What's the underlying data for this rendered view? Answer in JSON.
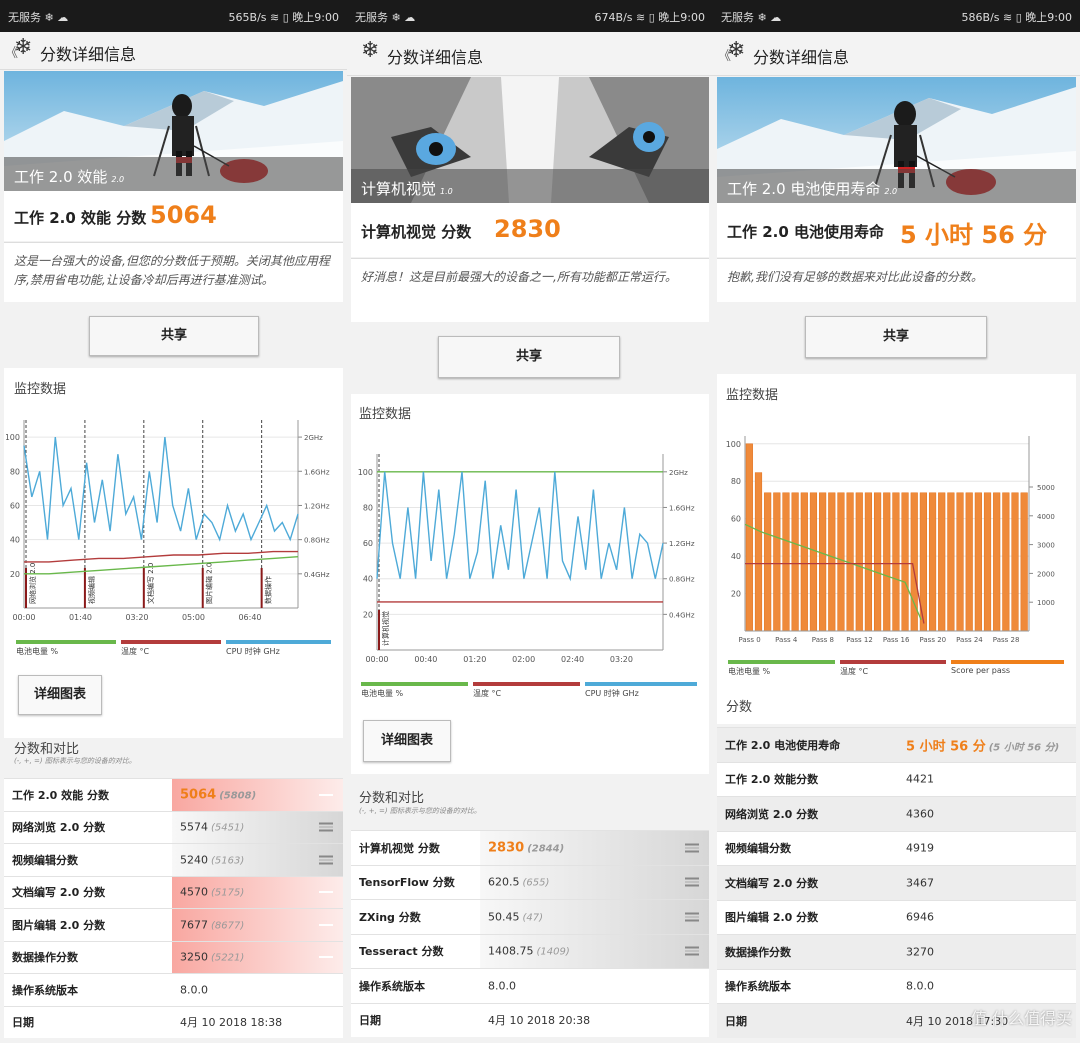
{
  "panels": [
    {
      "status": {
        "left": "无服务 ❄ ☁",
        "right": "565B/s ≋ ▯ 晚上9:00"
      },
      "title": "分数详细信息",
      "hero": {
        "name": "工作 2.0 效能",
        "version": "2.0"
      },
      "score": {
        "label": "工作 2.0 效能 分数",
        "value": "5064"
      },
      "description": "这是一台强大的设备,但您的分数低于预期。关闭其他应用程序,禁用省电功能,让设备冷却后再进行基准测试。",
      "share_label": "共享",
      "monitor_title": "监控数据",
      "chart_data": {
        "type": "line",
        "y_left_ticks": [
          "100",
          "80",
          "60",
          "40",
          "20"
        ],
        "y_right_ticks": [
          "2GHz",
          "1.6GHz",
          "1.2GHz",
          "0.8GHz",
          "0.4GHz"
        ],
        "x_ticks": [
          "00:00",
          "01:40",
          "03:20",
          "05:00",
          "06:40"
        ],
        "markers": [
          "网络浏览 2.0",
          "视频编辑",
          "文档编写 2.0",
          "图片编辑 2.0",
          "数据操作"
        ],
        "series": [
          {
            "name": "电池电量 %",
            "color": "#69b84b",
            "values": [
              20,
              20,
              21,
              22,
              23,
              24,
              25,
              26,
              27,
              28,
              29,
              30
            ]
          },
          {
            "name": "温度 °C",
            "color": "#b33c3c",
            "values": [
              27,
              27,
              28,
              29,
              29,
              30,
              31,
              31,
              32,
              32,
              33,
              33
            ]
          },
          {
            "name": "CPU 时钟 GHz",
            "color": "#4eaad8",
            "values": [
              1.9,
              1.3,
              1.6,
              0.8,
              2.0,
              1.2,
              1.4,
              0.8,
              1.7,
              1.0,
              1.5,
              0.9,
              1.8,
              1.1,
              1.3,
              0.8,
              1.6,
              1.0,
              2.0,
              1.2,
              0.9,
              1.4,
              0.8,
              1.1,
              1.0,
              0.8,
              1.2,
              0.9,
              1.1,
              0.8,
              1.0,
              1.2,
              0.9,
              1.0,
              0.8,
              1.1
            ]
          }
        ]
      },
      "legend": [
        "电池电量 %",
        "温度 °C",
        "CPU 时钟 GHz"
      ],
      "detail_button": "详细图表",
      "compare_title": "分数和对比",
      "compare_sub": "(-, +, =) 图标表示与您的设备的对比。",
      "rows": [
        {
          "k": "工作 2.0 效能 分数",
          "v": "5064",
          "ref": "(5808)",
          "sym": "−"
        },
        {
          "k": "网络浏览 2.0 分数",
          "v": "5574",
          "ref": "(5451)",
          "sym": "="
        },
        {
          "k": "视频编辑分数",
          "v": "5240",
          "ref": "(5163)",
          "sym": "="
        },
        {
          "k": "文档编写 2.0 分数",
          "v": "4570",
          "ref": "(5175)",
          "sym": "−"
        },
        {
          "k": "图片编辑 2.0 分数",
          "v": "7677",
          "ref": "(8677)",
          "sym": "−"
        },
        {
          "k": "数据操作分数",
          "v": "3250",
          "ref": "(5221)",
          "sym": "−"
        },
        {
          "k": "操作系统版本",
          "v": "8.0.0",
          "ref": "",
          "sym": ""
        },
        {
          "k": "日期",
          "v": "4月 10 2018 18:38",
          "ref": "",
          "sym": ""
        }
      ]
    },
    {
      "status": {
        "left": "无服务 ❄ ☁",
        "right": "674B/s ≋ ▯ 晚上9:00"
      },
      "title": "分数详细信息",
      "hero": {
        "name": "计算机视觉",
        "version": "1.0"
      },
      "score": {
        "label": "计算机视觉 分数",
        "value": "2830"
      },
      "description": "好消息！这是目前最强大的设备之一,所有功能都正常运行。",
      "share_label": "共享",
      "monitor_title": "监控数据",
      "chart_data": {
        "type": "line",
        "y_left_ticks": [
          "100",
          "80",
          "60",
          "40",
          "20"
        ],
        "y_right_ticks": [
          "2GHz",
          "1.6GHz",
          "1.2GHz",
          "0.8GHz",
          "0.4GHz"
        ],
        "x_ticks": [
          "00:00",
          "00:40",
          "01:20",
          "02:00",
          "02:40",
          "03:20"
        ],
        "markers": [
          "计算机视觉"
        ],
        "series": [
          {
            "name": "电池电量 %",
            "color": "#69b84b",
            "values": [
              100,
              100,
              100,
              100,
              100,
              100,
              100,
              100,
              100,
              100
            ]
          },
          {
            "name": "温度 °C",
            "color": "#b33c3c",
            "values": [
              27,
              27,
              27,
              27,
              27,
              27,
              27,
              27,
              27,
              27
            ]
          },
          {
            "name": "CPU 时钟 GHz",
            "color": "#4eaad8",
            "values": [
              0.8,
              2.0,
              1.2,
              0.8,
              1.6,
              0.8,
              2.0,
              1.0,
              1.8,
              0.8,
              1.3,
              2.0,
              0.8,
              1.1,
              1.9,
              0.8,
              1.4,
              0.9,
              1.8,
              0.8,
              1.2,
              1.6,
              0.8,
              2.0,
              1.0,
              0.8,
              1.5,
              0.9,
              1.8,
              0.8,
              1.2,
              0.9,
              1.6,
              0.8,
              1.3,
              1.2,
              0.8,
              1.2
            ]
          }
        ]
      },
      "legend": [
        "电池电量 %",
        "温度 °C",
        "CPU 时钟 GHz"
      ],
      "detail_button": "详细图表",
      "compare_title": "分数和对比",
      "compare_sub": "(-, +, =) 图标表示与您的设备的对比。",
      "rows": [
        {
          "k": "计算机视觉 分数",
          "v": "2830",
          "ref": "(2844)",
          "sym": "="
        },
        {
          "k": "TensorFlow 分数",
          "v": "620.5",
          "ref": "(655)",
          "sym": "="
        },
        {
          "k": "ZXing 分数",
          "v": "50.45",
          "ref": "(47)",
          "sym": "="
        },
        {
          "k": "Tesseract 分数",
          "v": "1408.75",
          "ref": "(1409)",
          "sym": "="
        },
        {
          "k": "操作系统版本",
          "v": "8.0.0",
          "ref": "",
          "sym": ""
        },
        {
          "k": "日期",
          "v": "4月 10 2018 20:38",
          "ref": "",
          "sym": ""
        }
      ]
    },
    {
      "status": {
        "left": "无服务 ❄ ☁",
        "right": "586B/s ≋ ▯ 晚上9:00"
      },
      "title": "分数详细信息",
      "hero": {
        "name": "工作 2.0 电池使用寿命",
        "version": "2.0"
      },
      "score": {
        "label": "工作 2.0 电池使用寿命",
        "value": "5 小时 56 分"
      },
      "description": "抱歉,我们没有足够的数据来对比此设备的分数。",
      "share_label": "共享",
      "monitor_title": "监控数据",
      "chart_data": {
        "type": "bar",
        "y_left_ticks": [
          "100",
          "80",
          "60",
          "40",
          "20"
        ],
        "y_right_ticks": [
          "5000",
          "4000",
          "3000",
          "2000",
          "1000"
        ],
        "x_ticks": [
          "Pass 0",
          "Pass 4",
          "Pass 8",
          "Pass 12",
          "Pass 16",
          "Pass 20",
          "Pass 24",
          "Pass 28"
        ],
        "score_per_pass": [
          6500,
          5500,
          4800,
          4800,
          4800,
          4800,
          4800,
          4800,
          4800,
          4800,
          4800,
          4800,
          4800,
          4800,
          4800,
          4800,
          4800,
          4800,
          4800,
          4800,
          4800,
          4800,
          4800,
          4800,
          4800,
          4800,
          4800,
          4800,
          4800,
          4800,
          4800
        ],
        "series": [
          {
            "name": "电池电量 %",
            "color": "#69b84b",
            "values": [
              57,
              53,
              50,
              47,
              44,
              41,
              38,
              35,
              32,
              29,
              26,
              6
            ]
          },
          {
            "name": "温度 °C",
            "color": "#b33c3c",
            "values": [
              36,
              36,
              36,
              36,
              36,
              36,
              36,
              36,
              36,
              36,
              36,
              36
            ]
          }
        ]
      },
      "legend": [
        "电池电量 %",
        "温度 °C",
        "Score per pass"
      ],
      "score_section": "分数",
      "rows": [
        {
          "k": "工作 2.0 电池使用寿命",
          "v": "5 小时 56 分",
          "ref": "(5 小时 56 分)",
          "sym": ""
        },
        {
          "k": "工作 2.0 效能分数",
          "v": "4421",
          "ref": "",
          "sym": ""
        },
        {
          "k": "网络浏览 2.0 分数",
          "v": "4360",
          "ref": "",
          "sym": ""
        },
        {
          "k": "视频编辑分数",
          "v": "4919",
          "ref": "",
          "sym": ""
        },
        {
          "k": "文档编写 2.0 分数",
          "v": "3467",
          "ref": "",
          "sym": ""
        },
        {
          "k": "图片编辑 2.0 分数",
          "v": "6946",
          "ref": "",
          "sym": ""
        },
        {
          "k": "数据操作分数",
          "v": "3270",
          "ref": "",
          "sym": ""
        },
        {
          "k": "操作系统版本",
          "v": "8.0.0",
          "ref": "",
          "sym": ""
        },
        {
          "k": "日期",
          "v": "4月 10 2018 17:30",
          "ref": "",
          "sym": ""
        }
      ],
      "watermark": "值 什么值得买"
    }
  ]
}
